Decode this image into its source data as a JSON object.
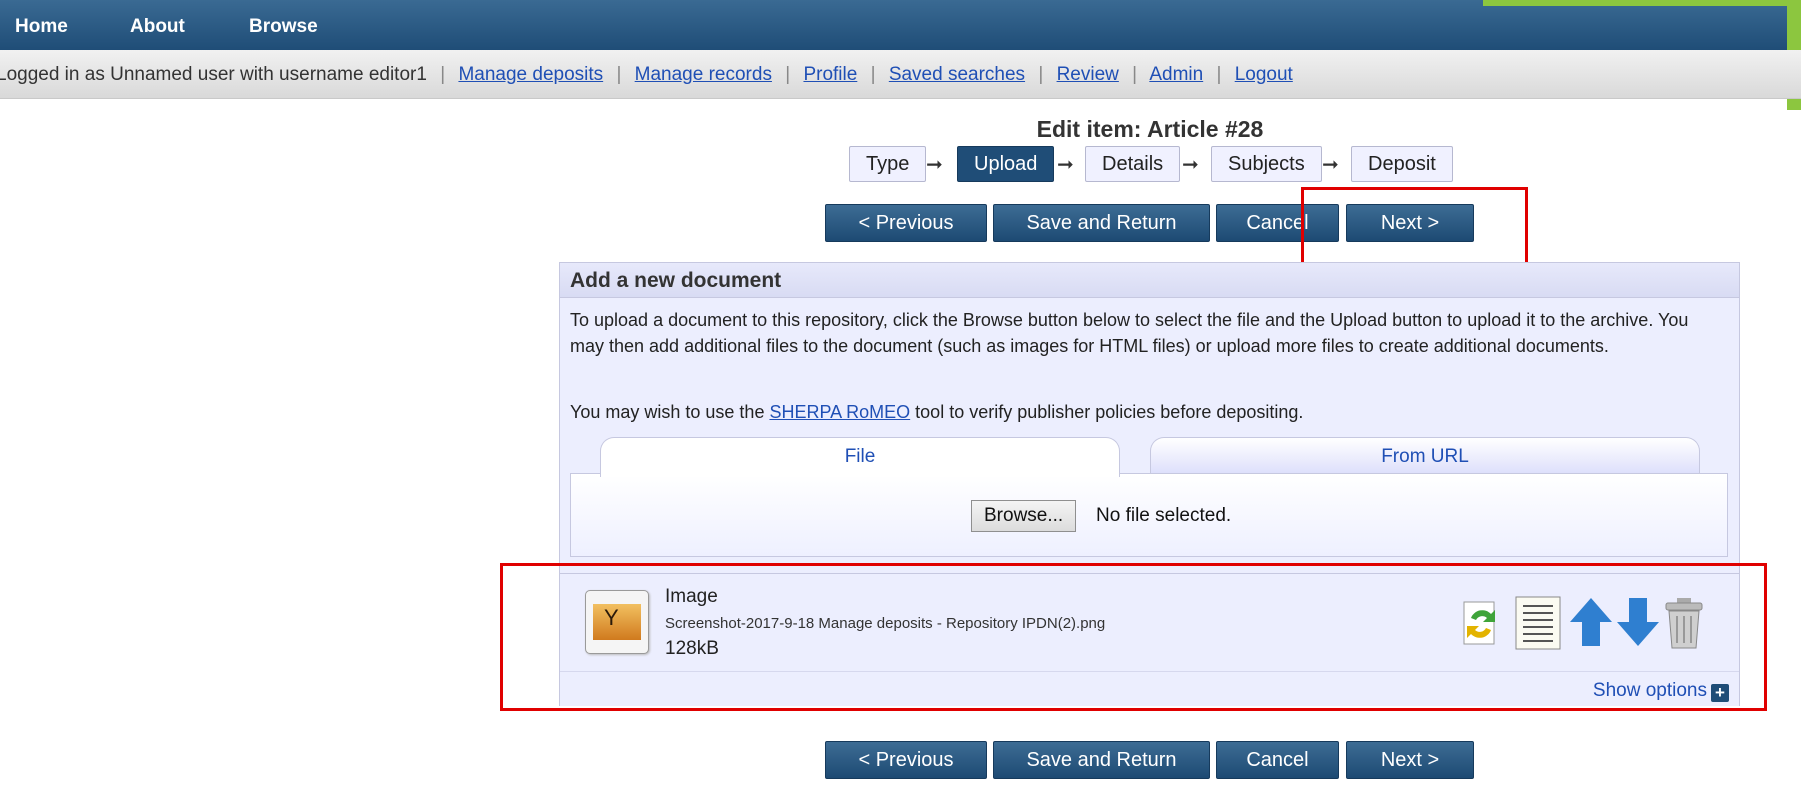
{
  "nav": {
    "items": [
      "Home",
      "About",
      "Browse"
    ]
  },
  "login": {
    "text": "Logged in as Unnamed user with username editor1",
    "links": [
      "Manage deposits",
      "Manage records",
      "Profile",
      "Saved searches",
      "Review",
      "Admin",
      "Logout"
    ]
  },
  "page": {
    "title": "Edit item: Article #28"
  },
  "workflow": {
    "steps": [
      "Type",
      "Upload",
      "Details",
      "Subjects",
      "Deposit"
    ],
    "active": "Upload"
  },
  "buttons": {
    "previous": "< Previous",
    "save": "Save and Return",
    "cancel": "Cancel",
    "next": "Next >"
  },
  "panel": {
    "title": "Add a new document",
    "description": "To upload a document to this repository, click the Browse button below to select the file and the Upload button to upload it to the archive. You may then add additional files to the document (such as images for HTML files) or upload more files to create additional documents.",
    "hint_prefix": "You may wish to use the ",
    "hint_link": "SHERPA RoMEO",
    "hint_suffix": " tool to verify publisher policies before depositing.",
    "tabs": [
      "File",
      "From URL"
    ],
    "browse_label": "Browse...",
    "file_status": "No file selected."
  },
  "document": {
    "type": "Image",
    "filename": "Screenshot-2017-9-18 Manage deposits - Repository IPDN(2).png",
    "size": "128kB",
    "show_options": "Show options",
    "actions": [
      "update-icon",
      "metadata-icon",
      "move-up-icon",
      "move-down-icon",
      "delete-icon"
    ]
  },
  "colors": {
    "nav_bg": "#1f4d77",
    "link": "#1f4fb5",
    "panel_bg": "#eceefe",
    "highlight": "#e00000",
    "accent_green": "#8cc63f"
  }
}
